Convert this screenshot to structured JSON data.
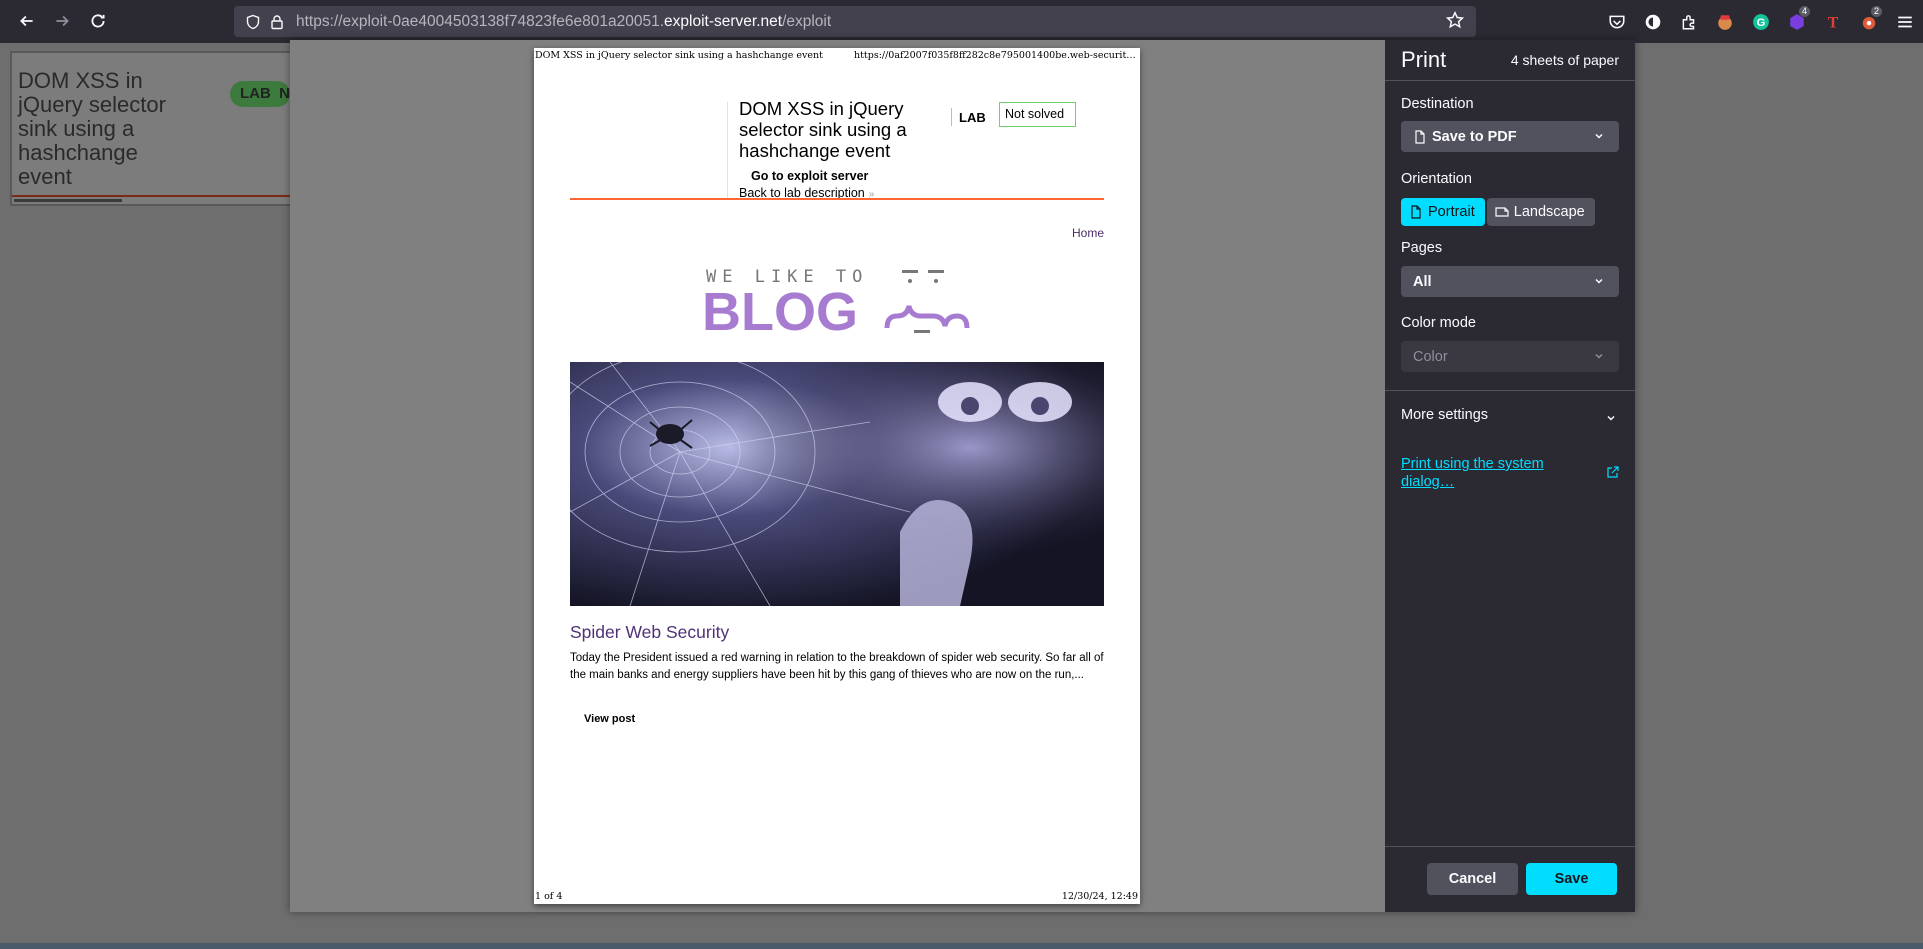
{
  "browser": {
    "url_prefix": "https://exploit-0ae4004503138f74823fe6e801a20051.",
    "url_domain": "exploit-server.net",
    "url_path": "/exploit",
    "extension_badges": [
      "4",
      "2"
    ]
  },
  "background_page": {
    "title": "DOM XSS in jQuery selector sink using a hashchange event",
    "lab_badge": "LAB",
    "status_partial": "N"
  },
  "preview": {
    "header_left": "DOM XSS in jQuery selector sink using a hashchange event",
    "header_right": "https://0af2007f035f8ff282c8e795001400be.web-security-a...",
    "footer_left": "1 of 4",
    "footer_right": "12/30/24, 12:49",
    "lab_title": "DOM XSS in jQuery selector sink using a hashchange event",
    "lab_tag": "LAB",
    "lab_status": "Not solved",
    "exploit_link": "Go to exploit server",
    "back_link": "Back to lab description",
    "back_chevron": "»",
    "home_link": "Home",
    "logo_top": "WE LIKE TO",
    "logo_main": "BLOG",
    "post_title": "Spider Web Security",
    "post_summary": "Today the President issued a red warning in relation to the breakdown of spider web security. So far all of the main banks and energy suppliers have been hit by this gang of thieves who are now on the run,...",
    "view_post": "View post"
  },
  "print_panel": {
    "title": "Print",
    "sheets": "4 sheets of paper",
    "destination_label": "Destination",
    "destination_value": "Save to PDF",
    "orientation_label": "Orientation",
    "portrait": "Portrait",
    "landscape": "Landscape",
    "orientation_selected": "Portrait",
    "pages_label": "Pages",
    "pages_value": "All",
    "color_label": "Color mode",
    "color_value": "Color",
    "more_settings": "More settings",
    "system_dialog": "Print using the system dialog…",
    "cancel": "Cancel",
    "save": "Save"
  },
  "colors": {
    "accent": "#00ddff",
    "toolbar": "#2b2a33",
    "lab_orange": "#ff6633",
    "blog_purple": "#a77bcf",
    "status_green": "#70d16d"
  }
}
